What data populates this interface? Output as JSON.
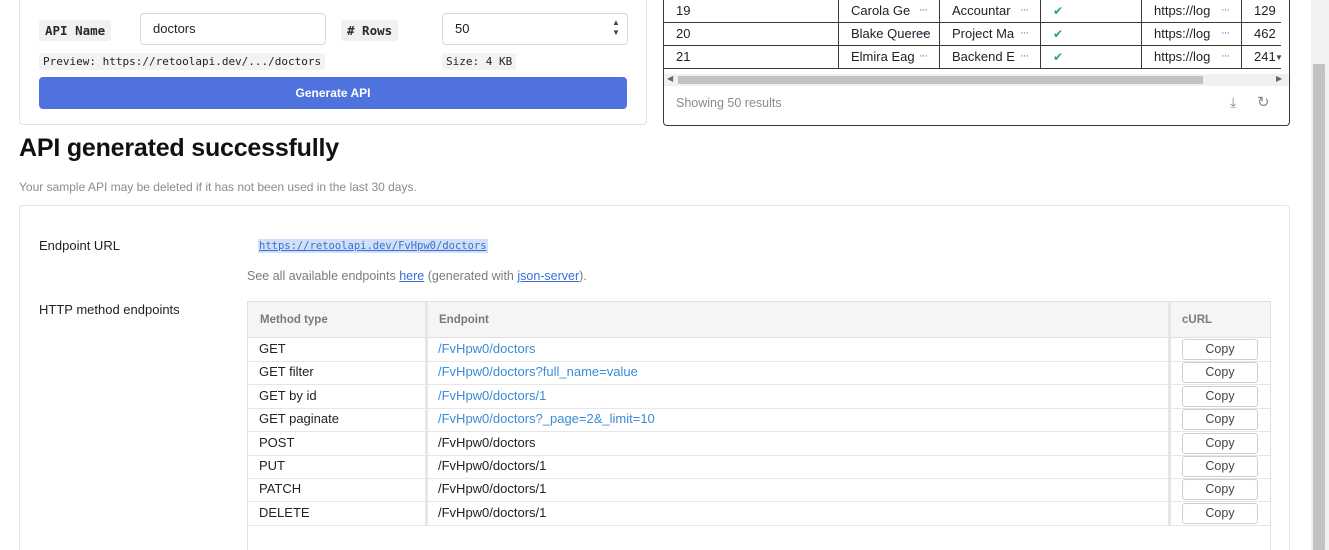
{
  "form": {
    "api_name_label": "API Name",
    "api_name_value": "doctors",
    "rows_label": "# Rows",
    "rows_value": "50",
    "preview_label": "Preview:",
    "preview_value": "https://retoolapi.dev/.../doctors",
    "size_label": "Size:",
    "size_value": "4 KB",
    "generate_label": "Generate API"
  },
  "results": {
    "rows": [
      {
        "id": "19",
        "name": "Carola Ge",
        "title": "Accountar",
        "ok": "✔",
        "url": "https://log",
        "num": "129"
      },
      {
        "id": "20",
        "name": "Blake Queree",
        "title": "Project Ma",
        "ok": "✔",
        "url": "https://log",
        "num": "462"
      },
      {
        "id": "21",
        "name": "Elmira Eag",
        "title": "Backend E",
        "ok": "✔",
        "url": "https://log",
        "num": "241"
      }
    ],
    "footer": "Showing 50 results",
    "accent": "#4f72de",
    "check_color": "#20a86a"
  },
  "page": {
    "title": "API generated successfully",
    "subtitle": "Your sample API may be deleted if it has not been used in the last 30 days."
  },
  "endpoint": {
    "label": "Endpoint URL",
    "url": "https://retoolapi.dev/FvHpw0/doctors",
    "note_prefix": "See all available endpoints ",
    "note_link1": "here",
    "note_middle": " (generated with ",
    "note_link2": "json-server",
    "note_suffix": ")."
  },
  "http": {
    "label": "HTTP method endpoints",
    "headers": [
      "Method type",
      "Endpoint",
      "cURL"
    ],
    "copy_label": "Copy",
    "link_color": "#3b8bd6",
    "rows": [
      {
        "method": "GET",
        "path": "/FvHpw0/doctors",
        "link": true
      },
      {
        "method": "GET filter",
        "path": "/FvHpw0/doctors?full_name=value",
        "link": true
      },
      {
        "method": "GET by id",
        "path": "/FvHpw0/doctors/1",
        "link": true
      },
      {
        "method": "GET paginate",
        "path": "/FvHpw0/doctors?_page=2&_limit=10",
        "link": true
      },
      {
        "method": "POST",
        "path": "/FvHpw0/doctors",
        "link": false
      },
      {
        "method": "PUT",
        "path": "/FvHpw0/doctors/1",
        "link": false
      },
      {
        "method": "PATCH",
        "path": "/FvHpw0/doctors/1",
        "link": false
      },
      {
        "method": "DELETE",
        "path": "/FvHpw0/doctors/1",
        "link": false
      }
    ]
  }
}
